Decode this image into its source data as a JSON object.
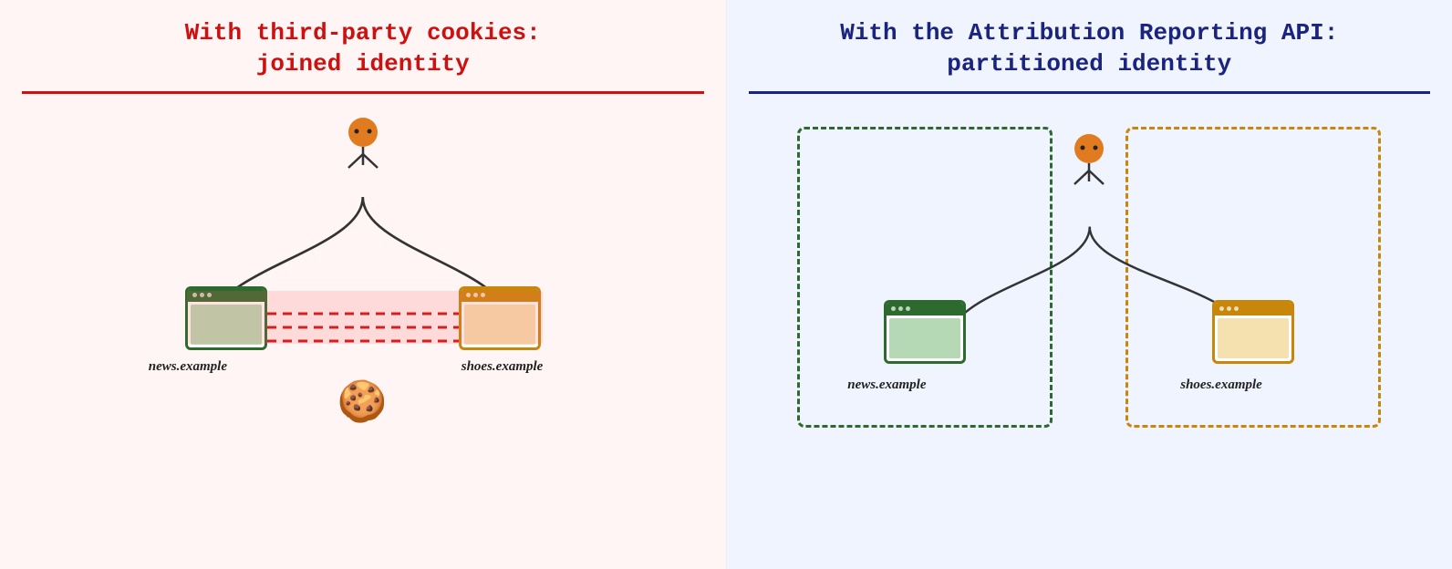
{
  "left_panel": {
    "title_line1": "With third-party cookies:",
    "title_line2": "joined identity",
    "title_color": "#cc1111",
    "divider_color": "#cc1111",
    "bg": "#fff5f5",
    "left_site": "news.example",
    "right_site": "shoes.example"
  },
  "right_panel": {
    "title_line1": "With the Attribution Reporting API:",
    "title_line2": "partitioned identity",
    "title_color": "#1a237e",
    "divider_color": "#1a237e",
    "bg": "#e8eeff",
    "left_site": "news.example",
    "right_site": "shoes.example"
  }
}
